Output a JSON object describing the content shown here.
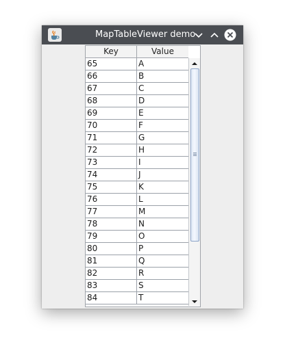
{
  "window": {
    "title": "MapTableViewer demo"
  },
  "table": {
    "columns": [
      "Key",
      "Value"
    ],
    "rows": [
      {
        "key": "65",
        "value": "A"
      },
      {
        "key": "66",
        "value": "B"
      },
      {
        "key": "67",
        "value": "C"
      },
      {
        "key": "68",
        "value": "D"
      },
      {
        "key": "69",
        "value": "E"
      },
      {
        "key": "70",
        "value": "F"
      },
      {
        "key": "71",
        "value": "G"
      },
      {
        "key": "72",
        "value": "H"
      },
      {
        "key": "73",
        "value": "I"
      },
      {
        "key": "74",
        "value": "J"
      },
      {
        "key": "75",
        "value": "K"
      },
      {
        "key": "76",
        "value": "L"
      },
      {
        "key": "77",
        "value": "M"
      },
      {
        "key": "78",
        "value": "N"
      },
      {
        "key": "79",
        "value": "O"
      },
      {
        "key": "80",
        "value": "P"
      },
      {
        "key": "81",
        "value": "Q"
      },
      {
        "key": "82",
        "value": "R"
      },
      {
        "key": "83",
        "value": "S"
      },
      {
        "key": "84",
        "value": "T"
      }
    ]
  },
  "icons": {
    "app": "java-app-icon",
    "minimize": "chevron-down-icon",
    "maximize": "chevron-up-icon",
    "close": "close-icon",
    "scroll_up": "scroll-up-arrow-icon",
    "scroll_down": "scroll-down-arrow-icon"
  },
  "colors": {
    "titlebar": "#4a4d52",
    "window_bg": "#eeeeee",
    "grid": "#9aa0a8",
    "thumb_border": "#8ea5c8"
  }
}
